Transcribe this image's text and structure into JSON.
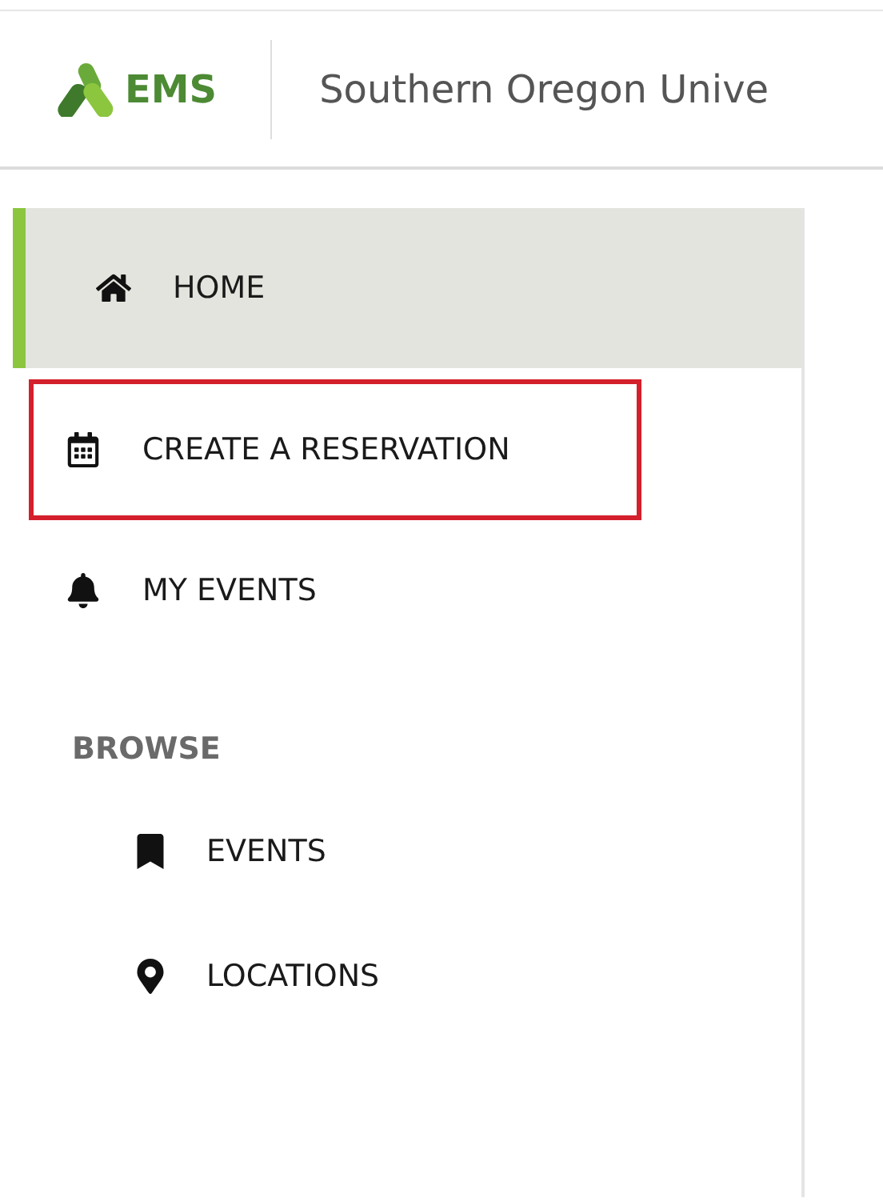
{
  "header": {
    "logo_text": "EMS",
    "title": "Southern Oregon Unive"
  },
  "sidebar": {
    "items": [
      {
        "label": "HOME",
        "kind": "home",
        "selected": true,
        "highlighted": false
      },
      {
        "label": "CREATE A RESERVATION",
        "kind": "calendar",
        "selected": false,
        "highlighted": true
      },
      {
        "label": "MY EVENTS",
        "kind": "bell",
        "selected": false,
        "highlighted": false
      }
    ],
    "section": {
      "label": "BROWSE",
      "children": [
        {
          "label": "EVENTS",
          "kind": "bookmark",
          "selected": false
        },
        {
          "label": "LOCATIONS",
          "kind": "pin",
          "selected": false
        }
      ]
    }
  }
}
